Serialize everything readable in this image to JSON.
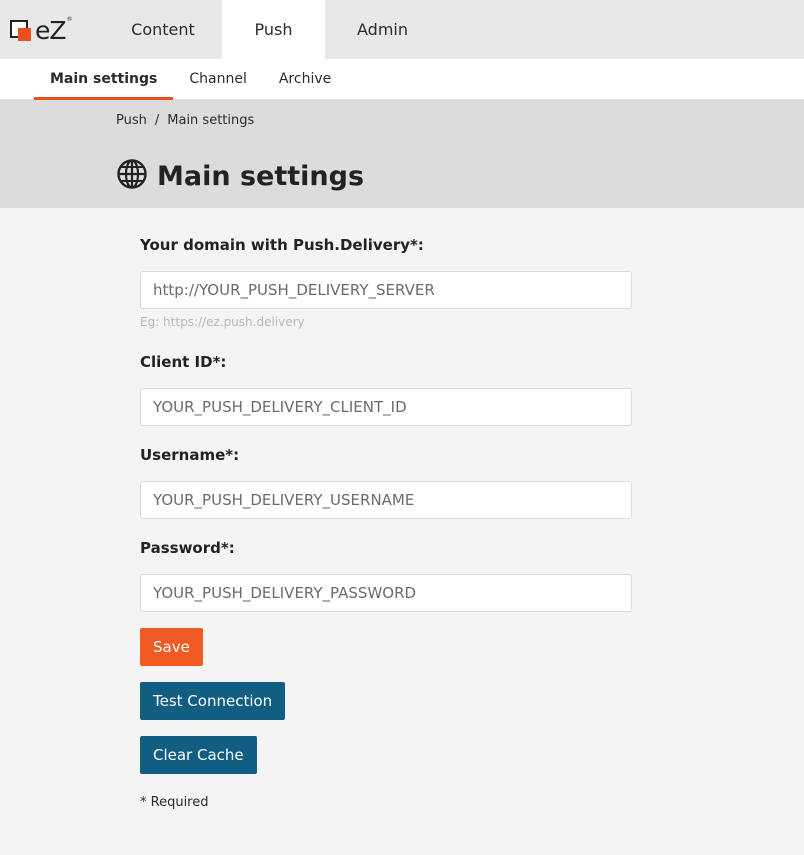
{
  "app": {
    "logo_text": "eZ",
    "logo_reg": "®"
  },
  "top_nav": {
    "tabs": [
      {
        "label": "Content"
      },
      {
        "label": "Push",
        "active": true
      },
      {
        "label": "Admin"
      }
    ]
  },
  "sub_nav": {
    "tabs": [
      {
        "label": "Main settings",
        "active": true
      },
      {
        "label": "Channel"
      },
      {
        "label": "Archive"
      }
    ]
  },
  "breadcrumb": {
    "items": [
      "Push",
      "Main settings"
    ],
    "separator": "/"
  },
  "page": {
    "title": "Main settings",
    "icon": "globe-icon"
  },
  "form": {
    "domain": {
      "label": "Your domain with Push.Delivery*:",
      "placeholder": "http://YOUR_PUSH_DELIVERY_SERVER",
      "hint": "Eg: https://ez.push.delivery"
    },
    "client_id": {
      "label": "Client ID*:",
      "placeholder": "YOUR_PUSH_DELIVERY_CLIENT_ID"
    },
    "username": {
      "label": "Username*:",
      "placeholder": "YOUR_PUSH_DELIVERY_USERNAME"
    },
    "password": {
      "label": "Password*:",
      "placeholder": "YOUR_PUSH_DELIVERY_PASSWORD"
    },
    "save_label": "Save",
    "test_connection_label": "Test Connection",
    "clear_cache_label": "Clear Cache",
    "required_note": "* Required"
  },
  "colors": {
    "accent": "#f15a22",
    "primary_button": "#125e83",
    "header_band": "#dcdcdc",
    "top_nav": "#e8e8e8"
  }
}
